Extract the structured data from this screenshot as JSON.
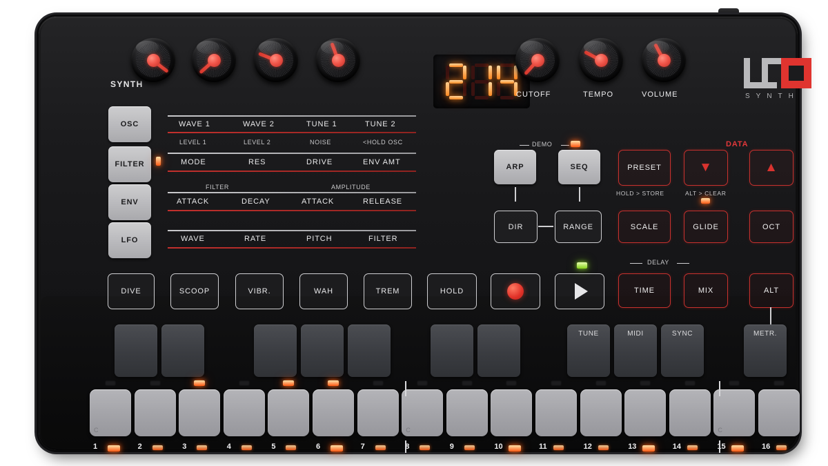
{
  "device": {
    "brand": "UNO",
    "sub_brand": "SYNTH",
    "section_title": "SYNTH"
  },
  "display": {
    "value": "214"
  },
  "knobs": [
    {
      "label": "WAVE 1 / LEVEL 1",
      "name": "knob-1",
      "angle": 218
    },
    {
      "label": "WAVE 2 / LEVEL 2",
      "name": "knob-2",
      "angle": 318
    },
    {
      "label": "TUNE 1 / NOISE",
      "name": "knob-3",
      "angle": 22
    },
    {
      "label": "TUNE 2 / HOLD OSC",
      "name": "knob-4",
      "angle": 70
    },
    {
      "label": "CUTOFF",
      "name": "knob-cutoff",
      "angle": 312
    },
    {
      "label": "TEMPO",
      "name": "knob-tempo",
      "angle": 28
    },
    {
      "label": "VOLUME",
      "name": "knob-volume",
      "angle": 62
    }
  ],
  "knob_labels": {
    "cutoff": "CUTOFF",
    "tempo": "TEMPO",
    "volume": "VOLUME"
  },
  "mode_buttons": [
    {
      "label": "OSC",
      "led": false
    },
    {
      "label": "FILTER",
      "led": true
    },
    {
      "label": "ENV",
      "led": false
    },
    {
      "label": "LFO",
      "led": false
    }
  ],
  "param_rows": [
    {
      "group": "osc",
      "primary": [
        "WAVE 1",
        "WAVE 2",
        "TUNE 1",
        "TUNE 2"
      ],
      "secondary": [
        "LEVEL 1",
        "LEVEL 2",
        "NOISE",
        "<HOLD OSC"
      ],
      "headers": []
    },
    {
      "group": "filter",
      "primary": [
        "MODE",
        "RES",
        "DRIVE",
        "ENV AMT"
      ],
      "secondary": [],
      "headers": []
    },
    {
      "group": "env",
      "primary": [
        "ATTACK",
        "DECAY",
        "ATTACK",
        "RELEASE"
      ],
      "secondary": [],
      "headers": [
        "FILTER",
        "AMPLITUDE"
      ]
    },
    {
      "group": "lfo",
      "primary": [
        "WAVE",
        "RATE",
        "PITCH",
        "FILTER"
      ],
      "secondary": [],
      "headers": []
    }
  ],
  "perf_buttons": [
    "DIVE",
    "SCOOP",
    "VIBR.",
    "WAH",
    "TREM"
  ],
  "seq_buttons": {
    "demo_label": "DEMO",
    "data_label": "DATA",
    "delay_label": "DELAY",
    "row1": [
      "ARP",
      "SEQ"
    ],
    "row1_right": [
      "PRESET"
    ],
    "data_down": "▼",
    "data_up": "▲",
    "row2": [
      "DIR",
      "RANGE"
    ],
    "row2_right": [
      "SCALE",
      "GLIDE",
      "OCT"
    ],
    "hold_store": "HOLD > STORE",
    "alt_clear": "ALT > CLEAR",
    "transport": [
      "HOLD",
      "REC",
      "PLAY"
    ],
    "delay_buttons": [
      "TIME",
      "MIX",
      "ALT"
    ]
  },
  "pad_row": {
    "labeled": [
      "TUNE",
      "MIDI",
      "SYNC",
      "METR."
    ]
  },
  "keyboard": {
    "key_numbers": [
      "1",
      "2",
      "3",
      "4",
      "5",
      "6",
      "7",
      "8",
      "9",
      "10",
      "11",
      "12",
      "13",
      "14",
      "15",
      "16"
    ],
    "c_marks": [
      1,
      8,
      15
    ],
    "bottom_leds_bright": [
      1,
      6,
      10,
      13,
      15
    ],
    "top_leds_lit": [
      3,
      5,
      6
    ]
  },
  "colors": {
    "accent_red": "#c8312e",
    "led_red": "#ff5a14",
    "led_green": "#86d21a",
    "panel": "#1b1b1d",
    "button_gray": "#bcbcc0"
  }
}
